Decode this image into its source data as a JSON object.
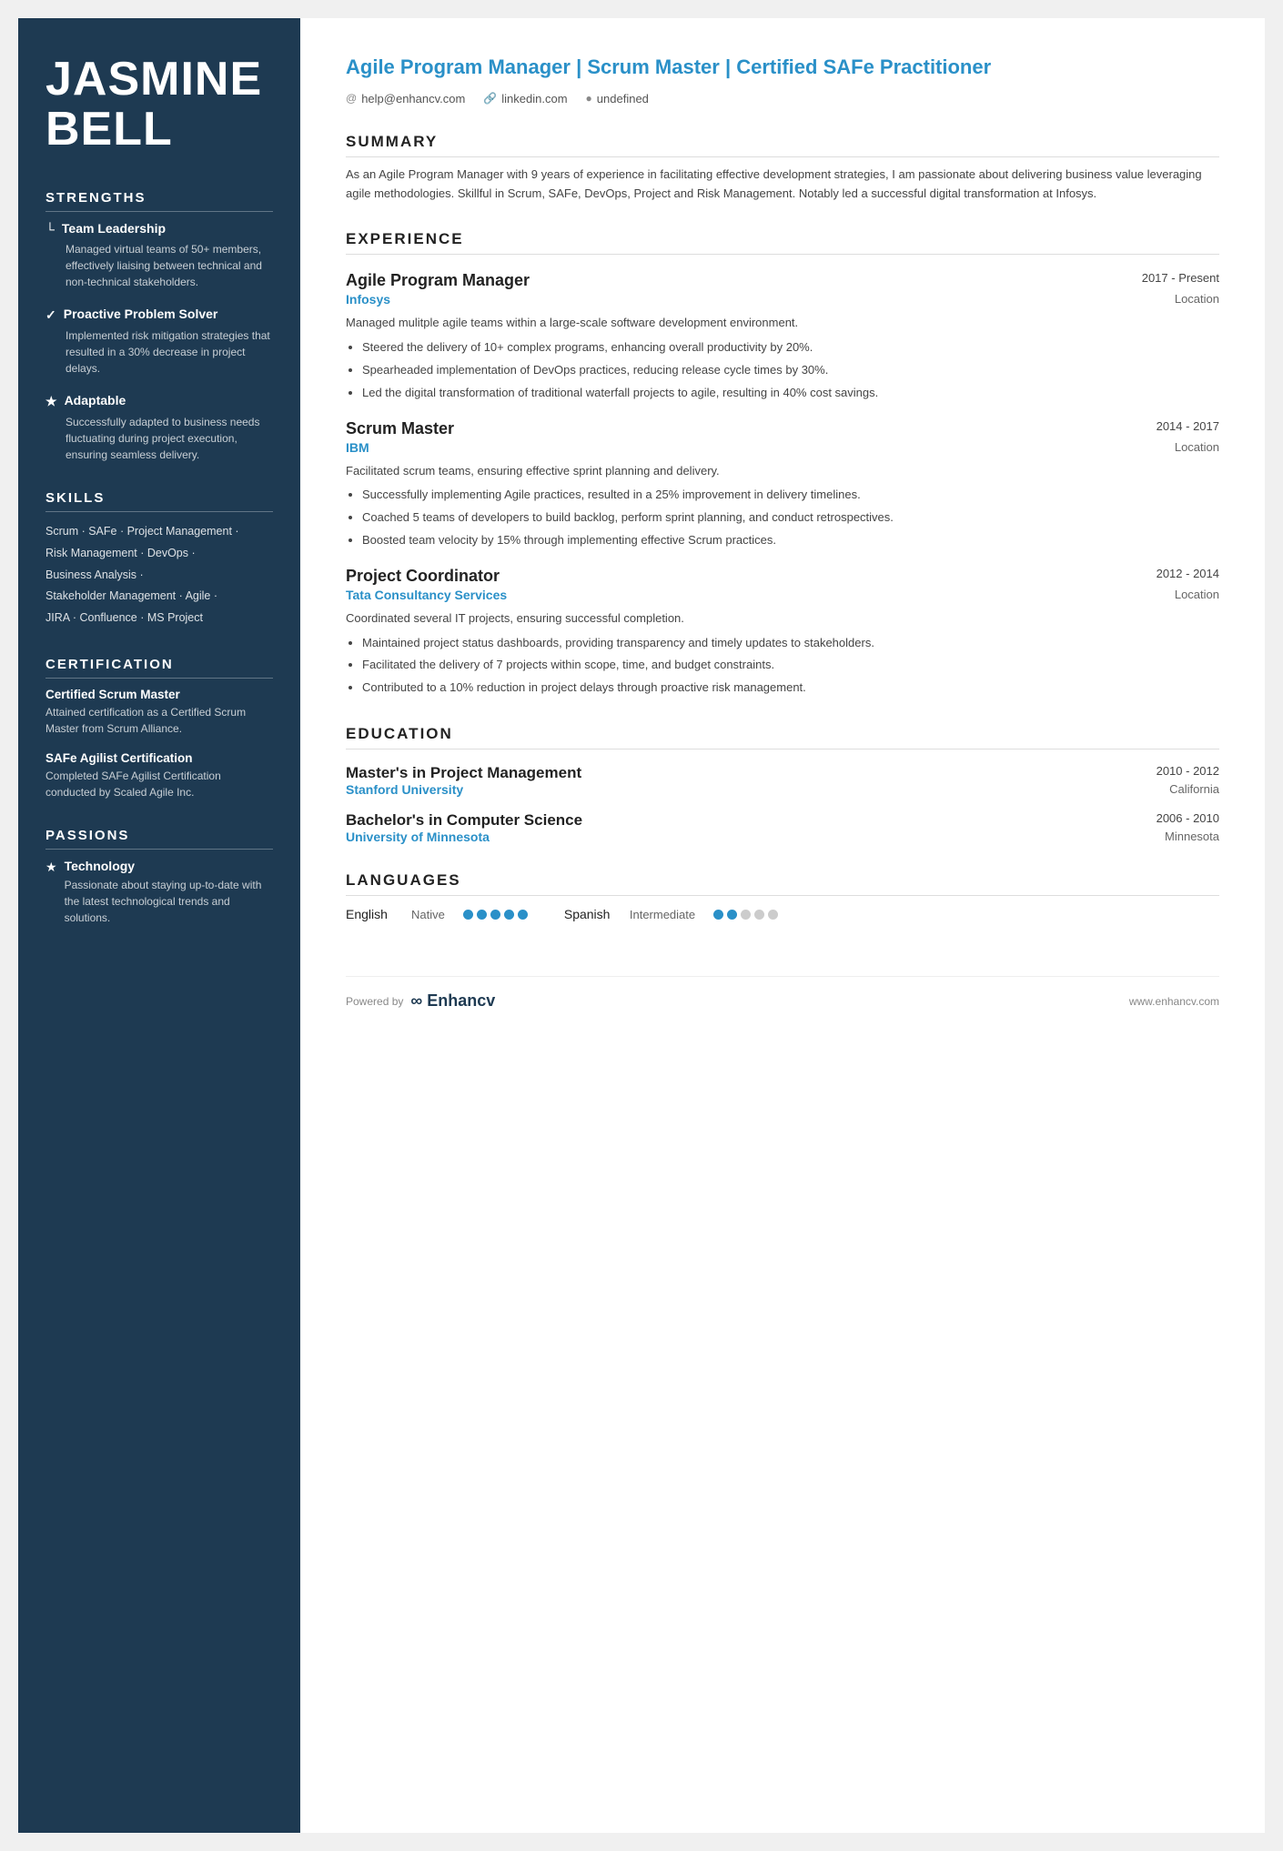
{
  "sidebar": {
    "name_line1": "JASMINE",
    "name_line2": "BELL",
    "strengths_title": "STRENGTHS",
    "strengths": [
      {
        "icon": "&#9492;",
        "heading": "Team Leadership",
        "desc": "Managed virtual teams of 50+ members, effectively liaising between technical and non-technical stakeholders."
      },
      {
        "icon": "&#10003;",
        "heading": "Proactive Problem Solver",
        "desc": "Implemented risk mitigation strategies that resulted in a 30% decrease in project delays."
      },
      {
        "icon": "&#9733;",
        "heading": "Adaptable",
        "desc": "Successfully adapted to business needs fluctuating during project execution, ensuring seamless delivery."
      }
    ],
    "skills_title": "SKILLS",
    "skills_lines": [
      "Scrum · SAFe · Project Management ·",
      "Risk Management · DevOps ·",
      "Business Analysis ·",
      "Stakeholder Management · Agile ·",
      "JIRA · Confluence · MS Project"
    ],
    "cert_title": "CERTIFICATION",
    "certifications": [
      {
        "name": "Certified Scrum Master",
        "desc": "Attained certification as a Certified Scrum Master from Scrum Alliance."
      },
      {
        "name": "SAFe Agilist Certification",
        "desc": "Completed SAFe Agilist Certification conducted by Scaled Agile Inc."
      }
    ],
    "passions_title": "PASSIONS",
    "passions": [
      {
        "icon": "&#9733;",
        "title": "Technology",
        "desc": "Passionate about staying up-to-date with the latest technological trends and solutions."
      }
    ]
  },
  "header": {
    "title": "Agile Program Manager | Scrum Master | Certified SAFe Practitioner",
    "email": "help@enhancv.com",
    "linkedin": "linkedin.com",
    "location": "undefined"
  },
  "summary": {
    "title": "SUMMARY",
    "text": "As an Agile Program Manager with 9 years of experience in facilitating effective development strategies, I am passionate about delivering business value leveraging agile methodologies. Skillful in Scrum, SAFe, DevOps, Project and Risk Management. Notably led a successful digital transformation at Infosys."
  },
  "experience": {
    "title": "EXPERIENCE",
    "jobs": [
      {
        "title": "Agile Program Manager",
        "date": "2017 - Present",
        "company": "Infosys",
        "location": "Location",
        "desc": "Managed mulitple agile teams within a large-scale software development environment.",
        "bullets": [
          "Steered the delivery of 10+ complex programs, enhancing overall productivity by 20%.",
          "Spearheaded implementation of DevOps practices, reducing release cycle times by 30%.",
          "Led the digital transformation of traditional waterfall projects to agile, resulting in 40% cost savings."
        ]
      },
      {
        "title": "Scrum Master",
        "date": "2014 - 2017",
        "company": "IBM",
        "location": "Location",
        "desc": "Facilitated scrum teams, ensuring effective sprint planning and delivery.",
        "bullets": [
          "Successfully implementing Agile practices, resulted in a 25% improvement in delivery timelines.",
          "Coached 5 teams of developers to build backlog, perform sprint planning, and conduct retrospectives.",
          "Boosted team velocity by 15% through implementing effective Scrum practices."
        ]
      },
      {
        "title": "Project Coordinator",
        "date": "2012 - 2014",
        "company": "Tata Consultancy Services",
        "location": "Location",
        "desc": "Coordinated several IT projects, ensuring successful completion.",
        "bullets": [
          "Maintained project status dashboards, providing transparency and timely updates to stakeholders.",
          "Facilitated the delivery of 7 projects within scope, time, and budget constraints.",
          "Contributed to a 10% reduction in project delays through proactive risk management."
        ]
      }
    ]
  },
  "education": {
    "title": "EDUCATION",
    "degrees": [
      {
        "degree": "Master's in Project Management",
        "date": "2010 - 2012",
        "school": "Stanford University",
        "location": "California"
      },
      {
        "degree": "Bachelor's in Computer Science",
        "date": "2006 - 2010",
        "school": "University of Minnesota",
        "location": "Minnesota"
      }
    ]
  },
  "languages": {
    "title": "LANGUAGES",
    "items": [
      {
        "name": "English",
        "level": "Native",
        "filled": 5,
        "total": 5
      },
      {
        "name": "Spanish",
        "level": "Intermediate",
        "filled": 2,
        "total": 5
      }
    ]
  },
  "footer": {
    "powered_by": "Powered by",
    "logo_text": "Enhancv",
    "url": "www.enhancv.com"
  }
}
